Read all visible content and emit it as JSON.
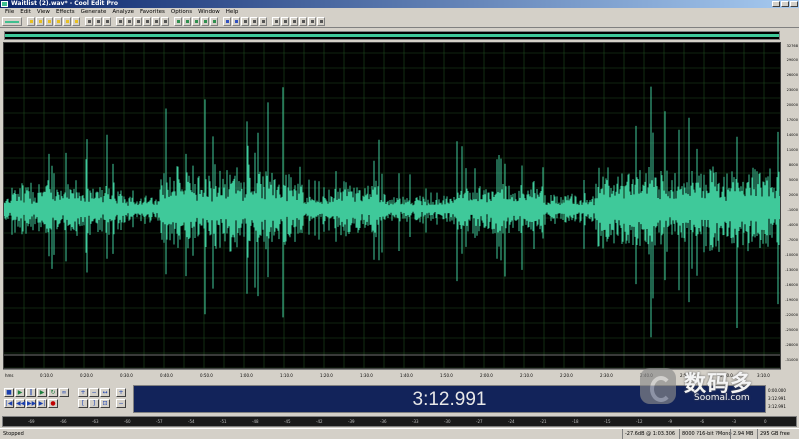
{
  "window": {
    "title": "Waitlist (2).wav* - Cool Edit Pro",
    "app_icon": "app-waveform-icon",
    "controls": [
      "minimize-icon",
      "maximize-icon",
      "close-icon"
    ]
  },
  "menu": {
    "items": [
      "File",
      "Edit",
      "View",
      "Effects",
      "Generate",
      "Analyze",
      "Favorites",
      "Options",
      "Window",
      "Help"
    ]
  },
  "transport": {
    "icons": [
      "stop-icon",
      "play-icon",
      "pause-icon",
      "play-to-end-icon",
      "loop-icon",
      "record-icon",
      "go-to-start-icon",
      "rewind-icon",
      "fast-forward-icon",
      "go-to-end-icon",
      "zoom-in-icon",
      "zoom-out-icon",
      "zoom-full-icon",
      "zoom-selection-icon"
    ]
  },
  "time_display": "3:12.991",
  "vertical_ruler": [
    "32768",
    "29000",
    "26000",
    "23000",
    "20000",
    "17000",
    "14000",
    "11000",
    "8000",
    "5000",
    "2000",
    "-1000",
    "-4000",
    "-7000",
    "-10000",
    "-13000",
    "-16000",
    "-19000",
    "-22000",
    "-25000",
    "-28000",
    "-31000"
  ],
  "time_ruler": [
    "hms",
    "0:10.0",
    "0:20.0",
    "0:30.0",
    "0:40.0",
    "0:50.0",
    "1:00.0",
    "1:10.0",
    "1:20.0",
    "1:30.0",
    "1:40.0",
    "1:50.0",
    "2:00.0",
    "2:10.0",
    "2:20.0",
    "2:30.0",
    "2:40.0",
    "2:50.0",
    "3:00.0",
    "3:10.0"
  ],
  "level_meter": [
    "-69",
    "-66",
    "-63",
    "-60",
    "-57",
    "-54",
    "-51",
    "-48",
    "-45",
    "-42",
    "-39",
    "-36",
    "-33",
    "-30",
    "-27",
    "-24",
    "-21",
    "-18",
    "-15",
    "-12",
    "-9",
    "-6",
    "-3",
    "0"
  ],
  "selection": {
    "begin": "0:00.000",
    "end": "3:12.991",
    "length": "3:12.991"
  },
  "status": {
    "state": "Stopped",
    "level": "-27.6dB @ 1:03.306",
    "format": "8000 ?16-bit ?Mono",
    "size": "2.94 MB",
    "free": "295 GB free"
  },
  "watermark": {
    "cn": "数码多",
    "en": "Soomal.com"
  },
  "colors": {
    "waveform": "#3fc99a",
    "wave_bg": "#000000",
    "grid": "#1f4a1f",
    "time_bg": "#12235a",
    "chrome": "#d4d0c8"
  }
}
